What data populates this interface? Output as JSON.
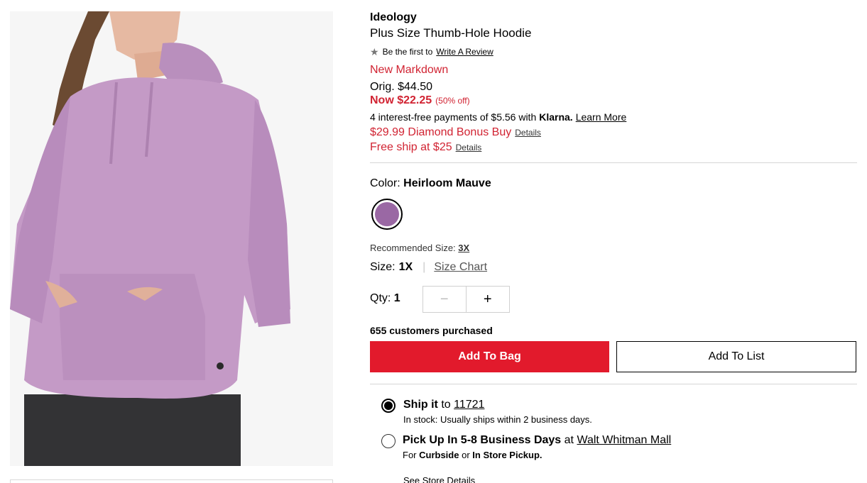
{
  "product": {
    "brand": "Ideology",
    "name": "Plus Size Thumb-Hole Hoodie",
    "image_alt_icon": "product-photo",
    "review": {
      "prefix": "Be the first to",
      "link": "Write A Review"
    },
    "pricing": {
      "badge": "New Markdown",
      "orig": "Orig. $44.50",
      "now": "Now $22.25",
      "discount": "(50% off)"
    },
    "klarna": {
      "text": "4 interest-free payments of $5.56 with",
      "brand": "Klarna.",
      "link": "Learn More"
    },
    "bonus": {
      "text": "$29.99 Diamond Bonus Buy",
      "link": "Details"
    },
    "free_ship": {
      "text": "Free ship at $25",
      "link": "Details"
    }
  },
  "color": {
    "label": "Color:",
    "value": "Heirloom Mauve",
    "swatch_color": "#9a68a4"
  },
  "size": {
    "recommended_label": "Recommended Size:",
    "recommended_value": "3X",
    "label": "Size:",
    "value": "1X",
    "chart_link": "Size Chart"
  },
  "quantity": {
    "label": "Qty:",
    "value": "1",
    "minus": "−",
    "plus": "+"
  },
  "purchase": {
    "customers": "655 customers purchased",
    "add_to_bag": "Add To Bag",
    "add_to_list": "Add To List"
  },
  "fulfillment": {
    "ship": {
      "bold": "Ship it",
      "to": "to",
      "zip": "11721",
      "sub": "In stock: Usually ships within 2 business days.",
      "selected": true
    },
    "pickup": {
      "bold": "Pick Up In 5-8 Business Days",
      "at": "at",
      "store": "Walt Whitman Mall",
      "sub_for": "For",
      "sub_curbside": "Curbside",
      "sub_or": "or",
      "sub_store": "In Store Pickup.",
      "selected": false
    },
    "store_details": "See Store Details"
  },
  "colors": {
    "accent_red": "#e21a2c",
    "price_red": "#d12332"
  }
}
